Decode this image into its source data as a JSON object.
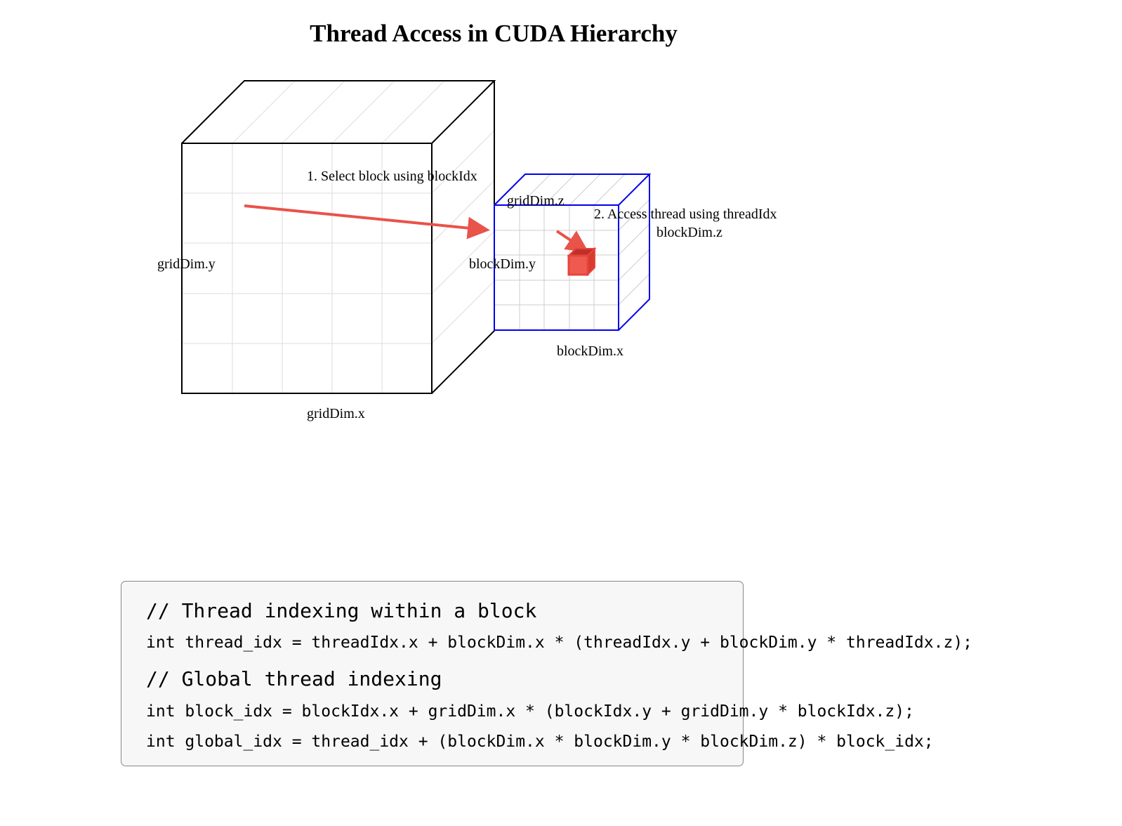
{
  "title": "Thread Access in CUDA Hierarchy",
  "labels": {
    "step1": "1. Select block using blockIdx",
    "step2": "2. Access thread using threadIdx",
    "grid_x": "gridDim.x",
    "grid_y": "gridDim.y",
    "grid_z": "gridDim.z",
    "block_x": "blockDim.x",
    "block_y": "blockDim.y",
    "block_z": "blockDim.z"
  },
  "colors": {
    "grid_cube": "#000000",
    "block_cube": "#0000ee",
    "arrow": "#e8534a",
    "thread": "#e8443a",
    "grid_lines": "#dddddd"
  },
  "code": {
    "comment1": "// Thread indexing within a block",
    "line1": "int thread_idx = threadIdx.x + blockDim.x * (threadIdx.y + blockDim.y * threadIdx.z);",
    "comment2": "// Global thread indexing",
    "line2": "int block_idx = blockIdx.x + gridDim.x * (blockIdx.y + gridDim.y * blockIdx.z);",
    "line3": "int global_idx = thread_idx + (blockDim.x * blockDim.y * blockDim.z) * block_idx;"
  }
}
